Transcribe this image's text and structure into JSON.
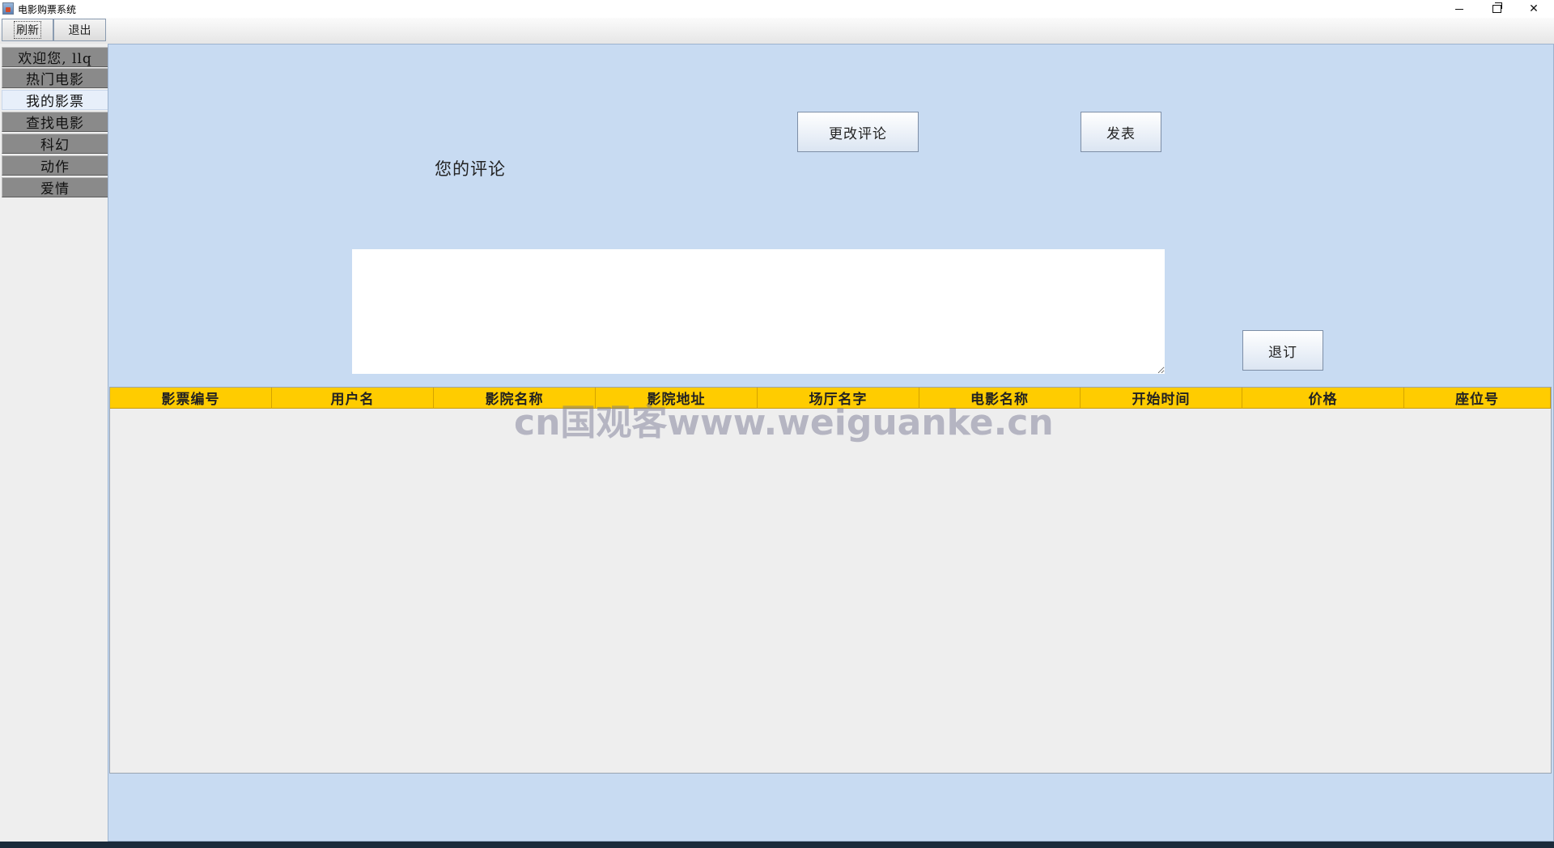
{
  "window": {
    "title": "电影购票系统"
  },
  "toolbar": {
    "refresh_label": "刷新",
    "exit_label": "退出"
  },
  "sidebar": {
    "items": [
      {
        "label": "欢迎您, llq"
      },
      {
        "label": "热门电影"
      },
      {
        "label": "我的影票"
      },
      {
        "label": "查找电影"
      },
      {
        "label": "科幻"
      },
      {
        "label": "动作"
      },
      {
        "label": "爱情"
      }
    ],
    "selected": "我的影票"
  },
  "review": {
    "label": "您的评论",
    "change_button": "更改评论",
    "publish_button": "发表",
    "text": ""
  },
  "refund_button": "退订",
  "table": {
    "columns": [
      "影票编号",
      "用户名",
      "影院名称",
      "影院地址",
      "场厅名字",
      "电影名称",
      "开始时间",
      "价格",
      "座位号"
    ],
    "rows": []
  },
  "watermark": "cn国观客www.weiguanke.cn",
  "colors": {
    "panel_background": "#c8dbf2",
    "table_header": "#ffcc00",
    "sidebar_tab": "#8a8a8a",
    "sidebar_tab_selected": "#e7effa"
  }
}
